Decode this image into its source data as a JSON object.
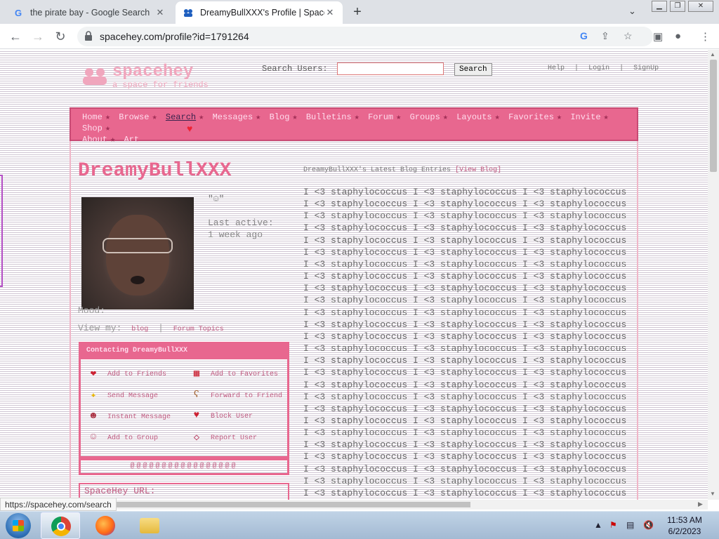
{
  "browser": {
    "tabs": [
      {
        "title": "the pirate bay - Google Search",
        "favicon": "google-g-icon",
        "active": false
      },
      {
        "title": "DreamyBullXXX's Profile | SpaceH",
        "favicon": "spacehey-icon",
        "active": true
      }
    ],
    "url": "spacehey.com/profile?id=1791264",
    "status_url": "https://spacehey.com/search"
  },
  "site": {
    "logo_name": "spacehey",
    "logo_tagline": "a space for friends",
    "search_label": "Search Users:",
    "search_value": "",
    "search_button": "Search",
    "top_links": [
      "Help",
      "|",
      "Login",
      "|",
      "SignUp"
    ]
  },
  "nav": {
    "items": [
      "Home",
      "Browse",
      "Search",
      "Messages",
      "Blog",
      "Bulletins",
      "Forum",
      "Groups",
      "Layouts",
      "Favorites",
      "Invite",
      "Shop",
      "About",
      "Art"
    ],
    "current": "Search",
    "separator": "★"
  },
  "profile": {
    "username": "DreamyBullXXX",
    "quote": "\"☺\"",
    "last_active_label": "Last active:",
    "last_active_value": "1 week ago",
    "mood_label": "Mood:",
    "view_my_label": "View my:",
    "view_my_links": [
      "blog",
      "|",
      "Forum Topics"
    ],
    "contact_header": "Contacting DreamyBullXXX",
    "contact_items": [
      {
        "label": "Add to Friends",
        "icon": "heart-apple-icon"
      },
      {
        "label": "Add to Favorites",
        "icon": "box-icon"
      },
      {
        "label": "Send Message",
        "icon": "sparkle-icon"
      },
      {
        "label": "Forward to Friend",
        "icon": "bear-icon"
      },
      {
        "label": "Instant Message",
        "icon": "face-icon"
      },
      {
        "label": "Block User",
        "icon": "broken-heart-icon"
      },
      {
        "label": "Add to Group",
        "icon": "group-icon"
      },
      {
        "label": "Report User",
        "icon": "flag-icon"
      }
    ],
    "contact_footer": "@@@@@@@@@@@@@@@@@",
    "url_label": "SpaceHey URL:"
  },
  "blog": {
    "title": "DreamyBullXXX's Latest Blog Entries",
    "view_blog": "[View Blog]",
    "line": "I <3 staphylococcus I <3 staphylococcus I <3 staphylococcus",
    "line_count": 26
  },
  "taskbar": {
    "time": "11:53 AM",
    "date": "6/2/2023"
  },
  "colors": {
    "accent": "#e8678f",
    "nav_current": "#3a234e"
  }
}
